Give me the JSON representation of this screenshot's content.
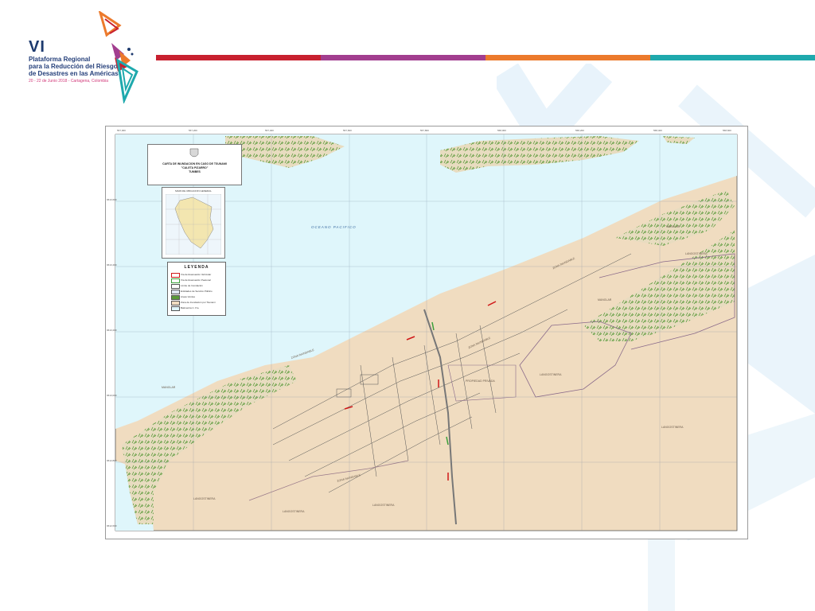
{
  "branding": {
    "number": "VI",
    "line1": "Plataforma Regional",
    "line2": "para la Reducción del Riesgo",
    "line3": "de Desastres en las Américas",
    "subline": "20 - 22 de Junio 2018 - Cartagena, Colombia"
  },
  "colors": {
    "bar_red": "#c8202f",
    "bar_purple": "#a23e8f",
    "bar_orange": "#ec7a2c",
    "bar_teal": "#1ea9ad",
    "ocean": "#dff6fb",
    "land": "#f0dcc0",
    "vegetation": "#5a9a3a"
  },
  "map": {
    "title_line1": "CARTA DE INUNDACION EN CASO DE TSUNAMI",
    "title_line2": "\"CALETA PIZARRO\"",
    "title_line3": "TUMBES",
    "locator_title": "MAPA DE UBICACION GENERAL",
    "ocean_label": "OCEANO PACIFICO",
    "legend": {
      "title": "LEYENDA",
      "items": [
        "Vía de Evacuación Vehicular",
        "Vía de Evacuación Peatonal",
        "Límite de Inundación",
        "Entidades de Servicio Público",
        "Areas Verdes",
        "Zona de Inundación por Tsunami",
        "Batimetría C. P.a."
      ]
    },
    "zone_labels": {
      "zona_inundable_1": "ZONA INUNDABLE",
      "zona_inundable_2": "ZONA INUNDABLE",
      "zona_inundable_3": "ZONA INUNDABLE",
      "zona_inundable_4": "ZONA INUNDABLE",
      "langostinera_1": "LANGOSTINERA",
      "langostinera_2": "LANGOSTINERA",
      "langostinera_3": "LANGOSTINERA",
      "langostinera_4": "LANGOSTINERA",
      "langostinera_5": "LANGOSTINERA",
      "langostinera_6": "LANGOSTINERA",
      "manglar_1": "MANGLAR",
      "manglar_2": "MANGLAR",
      "manglar_3": "MANGLAR",
      "propiedad": "PROPIEDAD PRIVADA"
    },
    "coords_top": [
      "567,000",
      "567,200",
      "567,400",
      "567,600",
      "567,800",
      "568,000",
      "568,200",
      "568,400",
      "568,600"
    ],
    "coords_left": [
      "9613,600",
      "9613,400",
      "9613,200",
      "9613,000",
      "9612,800",
      "9612,600"
    ]
  }
}
